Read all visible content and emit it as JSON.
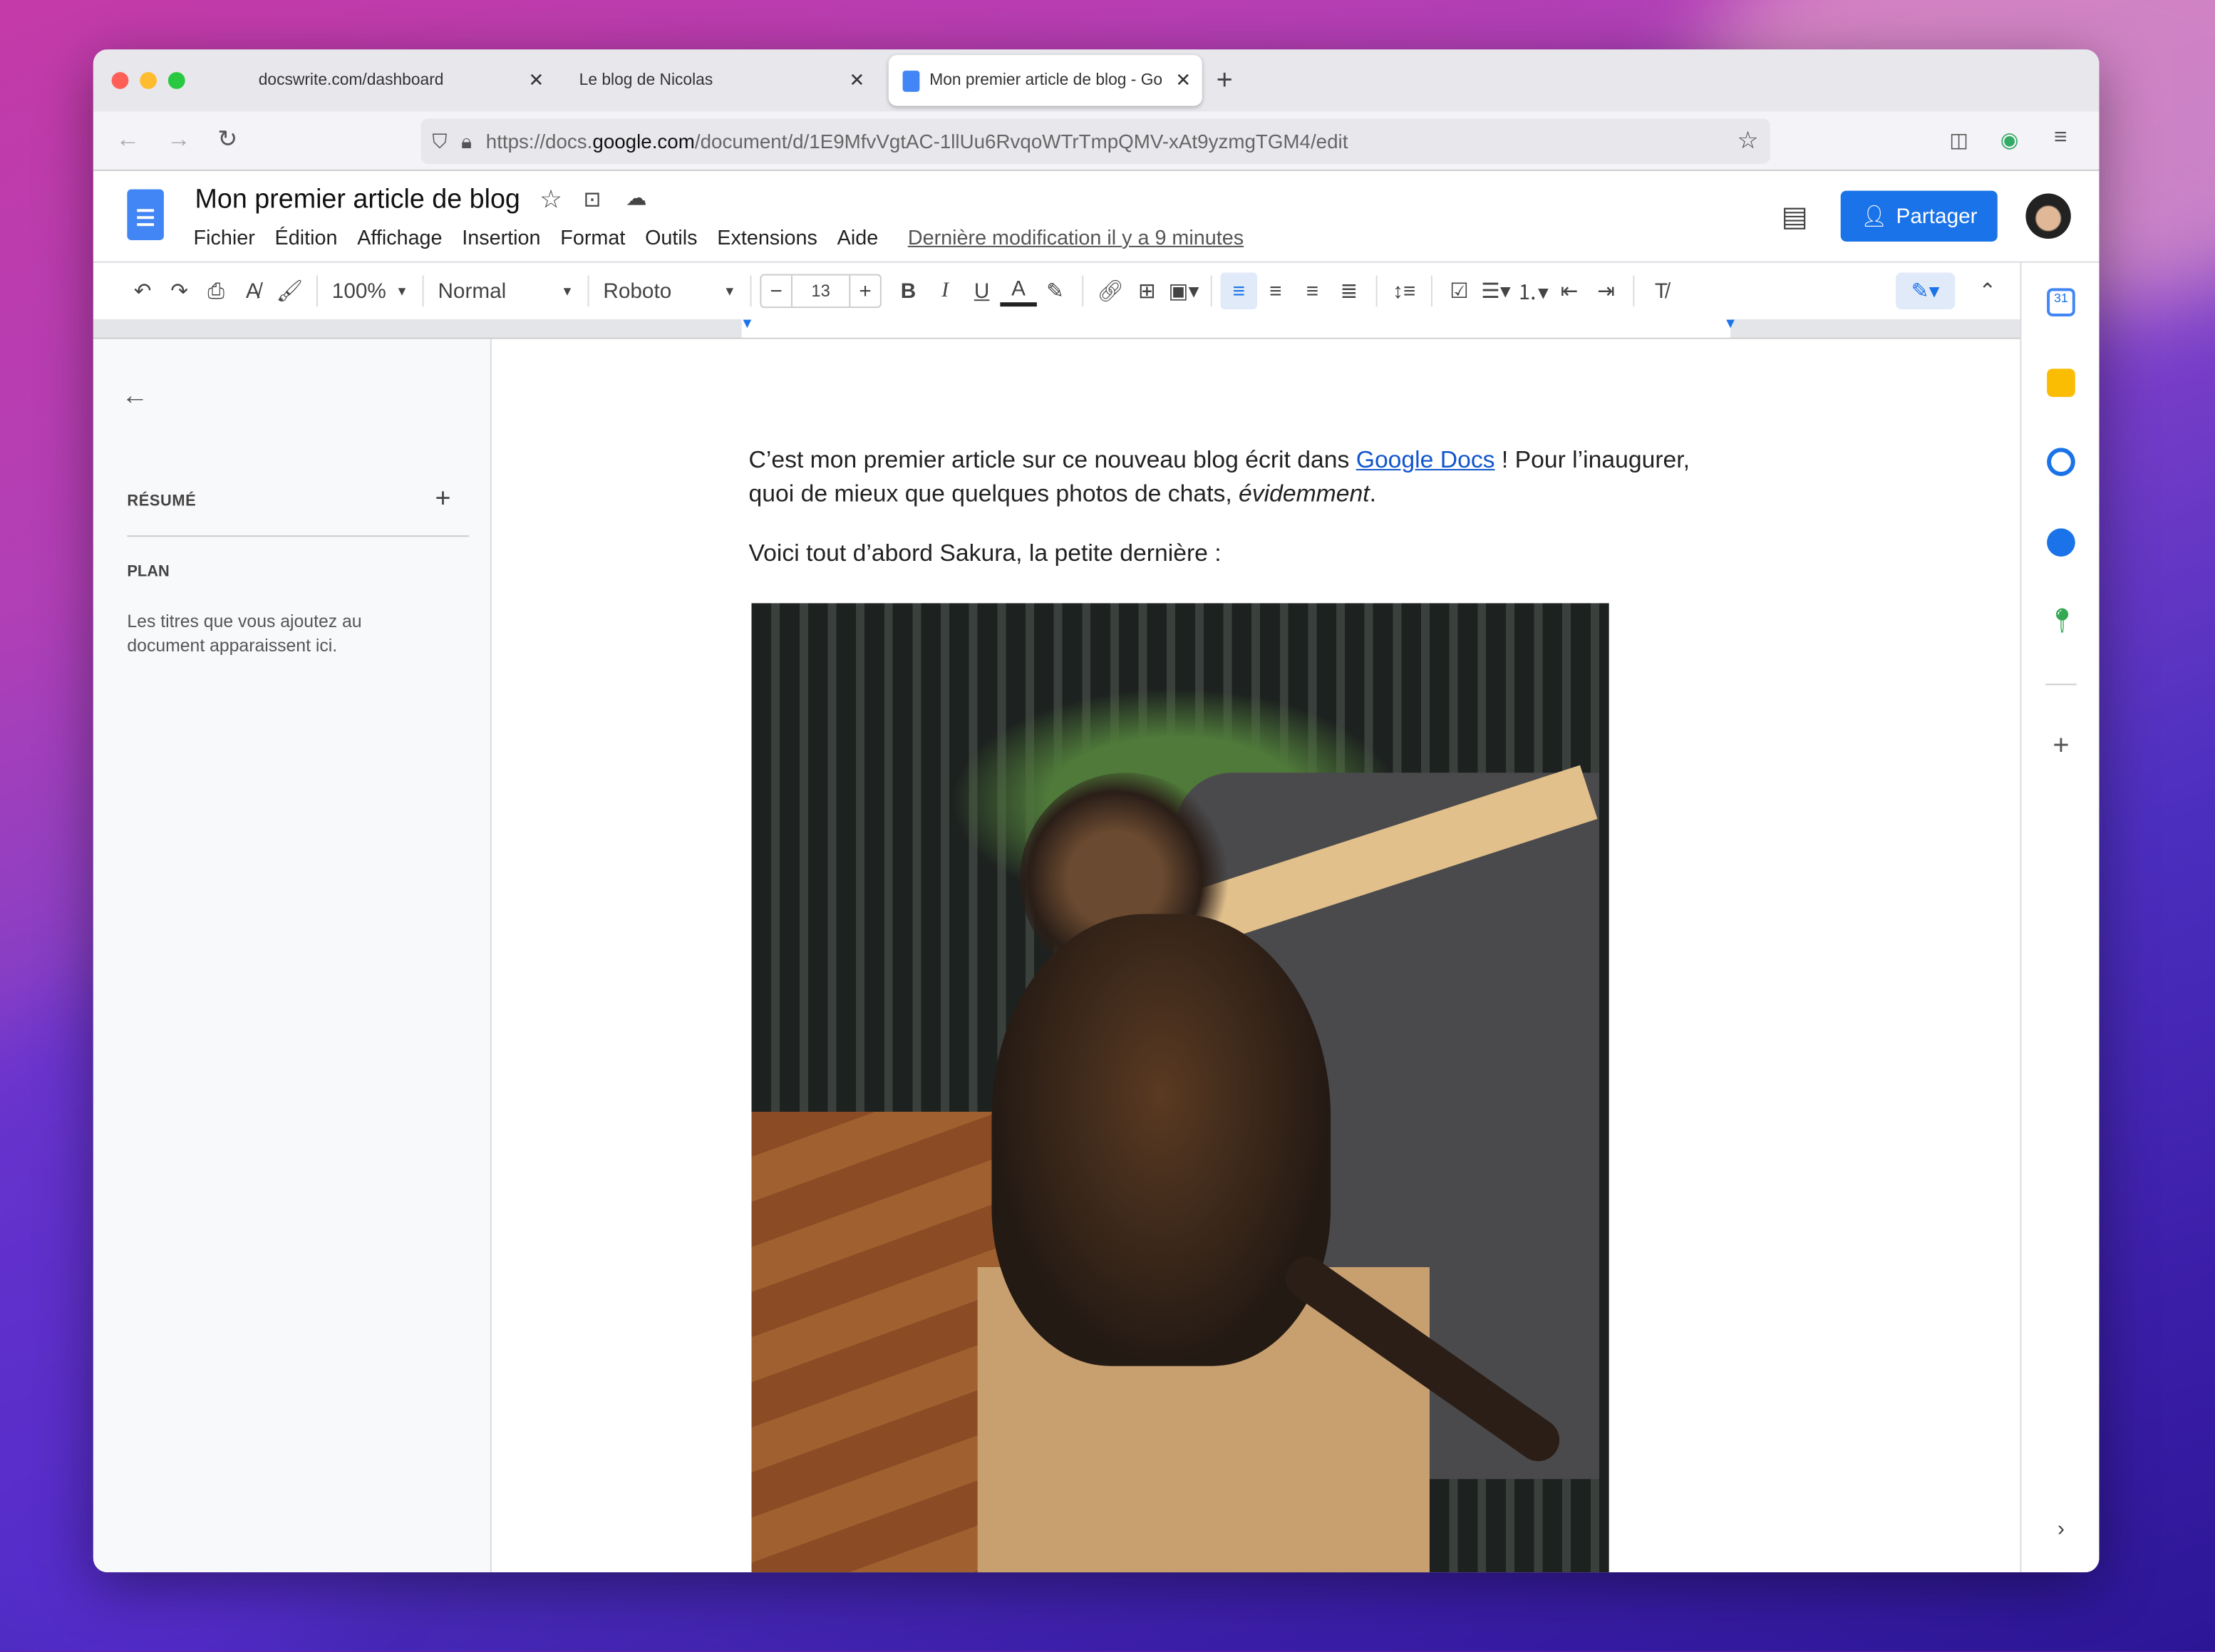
{
  "browser": {
    "tabs": [
      {
        "label": "docswrite.com/dashboard",
        "active": false
      },
      {
        "label": "Le blog de Nicolas",
        "active": false
      },
      {
        "label": "Mon premier article de blog - Go",
        "active": true
      }
    ],
    "new_tab": "+",
    "url_prefix": "https://docs.",
    "url_domain": "google.com",
    "url_suffix": "/document/d/1E9MfvVgtAC-1llUu6RvqoWTrTmpQMV-xAt9yzmgTGM4/edit"
  },
  "doc": {
    "title": "Mon premier article de blog",
    "menu": [
      "Fichier",
      "Édition",
      "Affichage",
      "Insertion",
      "Format",
      "Outils",
      "Extensions",
      "Aide"
    ],
    "last_edit": "Dernière modification il y a 9 minutes",
    "share_label": "Partager"
  },
  "toolbar": {
    "zoom": "100%",
    "style": "Normal",
    "font": "Roboto",
    "font_size": "13",
    "minus": "−",
    "plus": "+"
  },
  "outline": {
    "summary_label": "RÉSUMÉ",
    "plan_label": "PLAN",
    "plan_hint": "Les titres que vous ajoutez au document apparaissent ici."
  },
  "content": {
    "p1_a": "C’est mon premier article sur ce nouveau blog écrit dans ",
    "p1_link": "Google Docs",
    "p1_b": " ! Pour l’inaugurer, quoi de mieux que quelques photos de chats, ",
    "p1_em": "évidemment",
    "p1_end": ".",
    "p2": "Voici tout d’abord Sakura, la petite dernière :"
  },
  "colors": {
    "accent": "#1a73e8",
    "share": "#0b57d0",
    "link": "#1155cc"
  }
}
